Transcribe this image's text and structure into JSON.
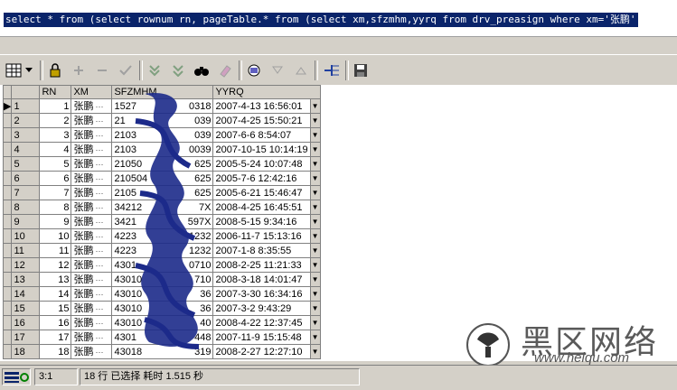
{
  "sql": {
    "text": "select * from (select rownum rn, pageTable.* from (select xm,sfzmhm,yyrq from drv_preasign where xm='张鹏'"
  },
  "toolbar": {
    "icons": [
      "grid-icon",
      "dropdown-arrow-icon",
      "lock-icon",
      "add-record-icon",
      "delete-record-icon",
      "post-record-icon",
      "query-icon",
      "clear-icon",
      "binoculars-icon",
      "eraser-icon",
      "describe-icon",
      "next-page-icon",
      "previous-page-icon",
      "fetch-all-icon",
      "save-icon"
    ]
  },
  "grid": {
    "columns": [
      "RN",
      "XM",
      "SFZMHM",
      "YYRQ"
    ],
    "rows": [
      {
        "hdr": "1",
        "rn": "1",
        "xm": "张鹏",
        "sfz": "1527",
        "sfz_end": "0318",
        "yyrq": "2007-4-13 16:56:01"
      },
      {
        "hdr": "2",
        "rn": "2",
        "xm": "张鹏",
        "sfz": "21",
        "sfz_end": "039",
        "yyrq": "2007-4-25 15:50:21"
      },
      {
        "hdr": "3",
        "rn": "3",
        "xm": "张鹏",
        "sfz": "2103",
        "sfz_end": "039",
        "yyrq": "2007-6-6 8:54:07"
      },
      {
        "hdr": "4",
        "rn": "4",
        "xm": "张鹏",
        "sfz": "2103",
        "sfz_end": "0039",
        "yyrq": "2007-10-15 10:14:19"
      },
      {
        "hdr": "5",
        "rn": "5",
        "xm": "张鹏",
        "sfz": "21050",
        "sfz_end": "625",
        "yyrq": "2005-5-24 10:07:48"
      },
      {
        "hdr": "6",
        "rn": "6",
        "xm": "张鹏",
        "sfz": "210504",
        "sfz_end": "625",
        "yyrq": "2005-7-6 12:42:16"
      },
      {
        "hdr": "7",
        "rn": "7",
        "xm": "张鹏",
        "sfz": "2105",
        "sfz_end": "625",
        "yyrq": "2005-6-21 15:46:47"
      },
      {
        "hdr": "8",
        "rn": "8",
        "xm": "张鹏",
        "sfz": "34212",
        "sfz_end": "7X",
        "yyrq": "2008-4-25 16:45:51"
      },
      {
        "hdr": "9",
        "rn": "9",
        "xm": "张鹏",
        "sfz": "3421",
        "sfz_end": "597X",
        "yyrq": "2008-5-15 9:34:16"
      },
      {
        "hdr": "10",
        "rn": "10",
        "xm": "张鹏",
        "sfz": "4223",
        "sfz_end": "1232",
        "yyrq": "2006-11-7 15:13:16"
      },
      {
        "hdr": "11",
        "rn": "11",
        "xm": "张鹏",
        "sfz": "4223",
        "sfz_end": "1232",
        "yyrq": "2007-1-8 8:35:55"
      },
      {
        "hdr": "12",
        "rn": "12",
        "xm": "张鹏",
        "sfz": "4301",
        "sfz_end": "0710",
        "yyrq": "2008-2-25 11:21:33"
      },
      {
        "hdr": "13",
        "rn": "13",
        "xm": "张鹏",
        "sfz": "43010",
        "sfz_end": "710",
        "yyrq": "2008-3-18 14:01:47"
      },
      {
        "hdr": "14",
        "rn": "14",
        "xm": "张鹏",
        "sfz": "43010",
        "sfz_end": "36",
        "yyrq": "2007-3-30 16:34:16"
      },
      {
        "hdr": "15",
        "rn": "15",
        "xm": "张鹏",
        "sfz": "43010",
        "sfz_end": "36",
        "yyrq": "2007-3-2 9:43:29"
      },
      {
        "hdr": "16",
        "rn": "16",
        "xm": "张鹏",
        "sfz": "43010",
        "sfz_end": "40",
        "yyrq": "2008-4-22 12:37:45"
      },
      {
        "hdr": "17",
        "rn": "17",
        "xm": "张鹏",
        "sfz": "4301",
        "sfz_end": "448",
        "yyrq": "2007-11-9 15:15:48"
      },
      {
        "hdr": "18",
        "rn": "18",
        "xm": "张鹏",
        "sfz": "43018",
        "sfz_end": "319",
        "yyrq": "2008-2-27 12:27:10"
      }
    ]
  },
  "status": {
    "position": "3:1",
    "message": "18 行 已选择 耗时 1.515 秒"
  },
  "watermark": {
    "main": "黑区网络",
    "url": "www.heiqu.com"
  }
}
